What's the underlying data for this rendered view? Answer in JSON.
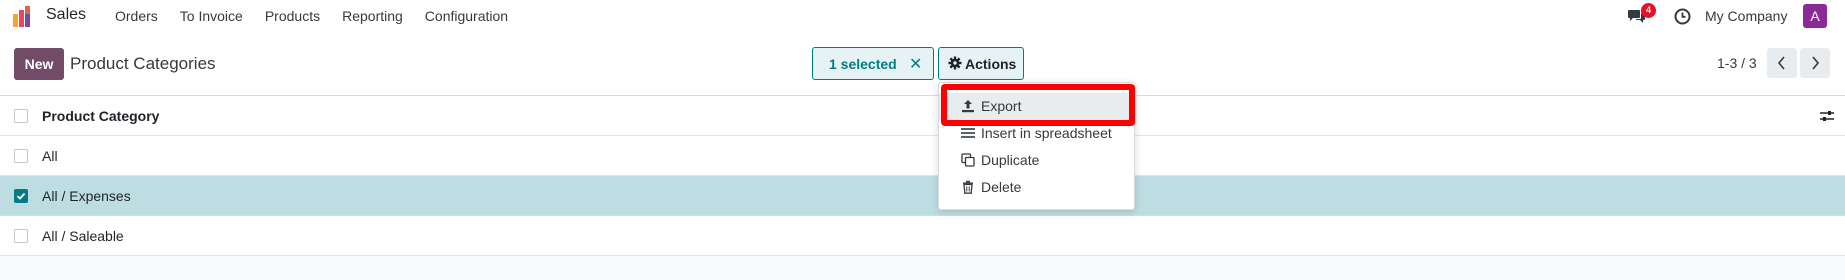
{
  "navbar": {
    "app_name": "Sales",
    "app_logo_icon": "odoo-app-icon",
    "menu": [
      "Orders",
      "To Invoice",
      "Products",
      "Reporting",
      "Configuration"
    ],
    "chat_icon": "chat-bubbles-icon",
    "chat_badge": "4",
    "clock_icon": "clock-icon",
    "company": "My Company",
    "avatar_letter": "A"
  },
  "control_panel": {
    "new_label": "New",
    "title": "Product Categories",
    "selected_label": "1 selected",
    "clear_selection_glyph": "✕",
    "actions_label": "Actions",
    "pager_value": "1-3 / 3"
  },
  "list": {
    "header": "Product Category",
    "rows": [
      {
        "label": "All",
        "checked": false
      },
      {
        "label": "All / Expenses",
        "checked": true
      },
      {
        "label": "All / Saleable",
        "checked": false
      }
    ]
  },
  "actions_menu": {
    "items": [
      {
        "label": "Export",
        "icon": "upload-icon"
      },
      {
        "label": "Insert in spreadsheet",
        "icon": "list-icon"
      },
      {
        "label": "Duplicate",
        "icon": "copy-icon"
      },
      {
        "label": "Delete",
        "icon": "trash-icon"
      }
    ]
  },
  "colors": {
    "brand": "#714b67",
    "accent": "#017e84",
    "selected_row": "#bedde2",
    "highlight": "#ff0000",
    "badge": "#e4122b",
    "avatar": "#8b2a94"
  }
}
